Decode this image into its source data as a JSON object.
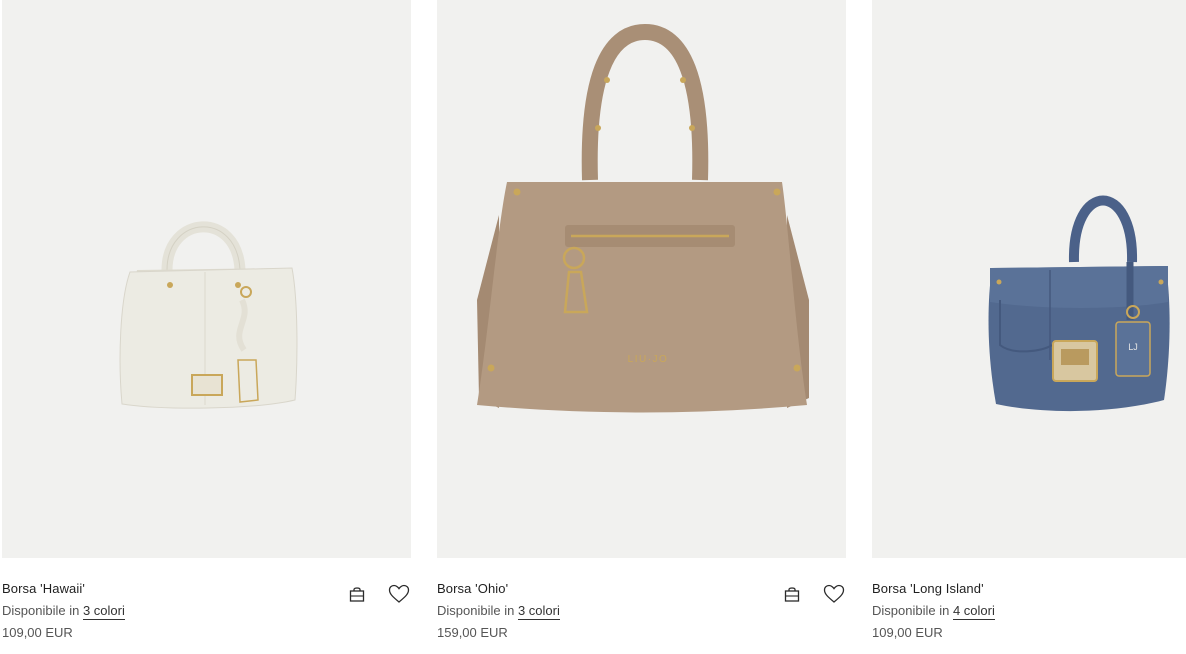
{
  "products": [
    {
      "name": "Borsa 'Hawaii'",
      "availability_prefix": "Disponibile in",
      "colors_link": "3 colori",
      "price": "109,00 EUR",
      "image_icon": "white-handbag-image",
      "bag_color": "#ecebe3",
      "has_actions": true
    },
    {
      "name": "Borsa 'Ohio'",
      "availability_prefix": "Disponibile in",
      "colors_link": "3 colori",
      "price": "159,00 EUR",
      "image_icon": "tan-handbag-image",
      "bag_color": "#b39a82",
      "brand_mark": "LIU·JO",
      "has_actions": true
    },
    {
      "name": "Borsa 'Long Island'",
      "availability_prefix": "Disponibile in",
      "colors_link": "4 colori",
      "price": "109,00 EUR",
      "image_icon": "blue-handbag-image",
      "bag_color": "#52698f",
      "brand_mark": "LJ",
      "has_actions": false
    }
  ],
  "colors": {
    "image_background": "#f1f1ef",
    "text": "#2b2b2b",
    "muted_text": "#555555",
    "hardware_gold": "#c9a75a"
  }
}
